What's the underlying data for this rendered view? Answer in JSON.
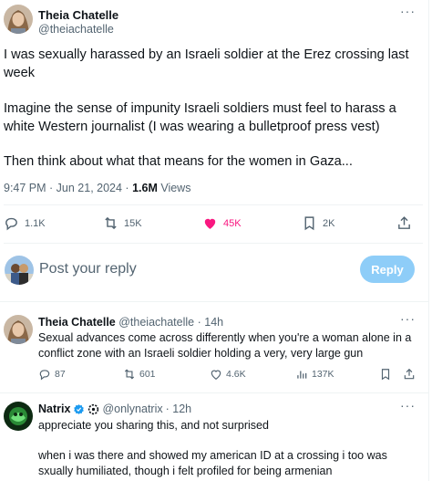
{
  "tweet": {
    "author_name": "Theia Chatelle",
    "author_handle": "@theiachatelle",
    "more": "···",
    "paragraphs": [
      "I was sexually harassed by an Israeli soldier at the Erez crossing last week",
      "Imagine the sense of impunity Israeli soldiers must feel to harass a white Western journalist (I was wearing a bulletproof press vest)",
      "Then think about what that means for the women in Gaza..."
    ],
    "time": "9:47 PM · Jun 21, 2024 · ",
    "views_count": "1.6M",
    "views_label": " Views",
    "actions": {
      "replies": "1.1K",
      "reposts": "15K",
      "likes": "45K",
      "bookmarks": "2K"
    },
    "like_color": "#f91880"
  },
  "reply_box": {
    "placeholder": "Post your reply",
    "button": "Reply"
  },
  "comments": [
    {
      "name": "Theia Chatelle",
      "handle": "@theiachatelle",
      "time": "· 14h",
      "more": "···",
      "text": "Sexual advances come across differently when you're a woman alone in a conflict zone with an Israeli soldier holding a very, very large gun",
      "replies": "87",
      "reposts": "601",
      "likes": "4.6K",
      "views": "137K"
    },
    {
      "name": "Natrix",
      "handle": "@onlynatrix",
      "time": "· 12h",
      "more": "···",
      "paragraphs": [
        "appreciate you sharing this, and not surprised",
        "when i was there and showed my american ID at a crossing i too was sxually humiliated, though i felt profiled for being armenian"
      ]
    }
  ],
  "colors": {
    "secondary_text": "#536471",
    "reply_button": "#8ecdf8",
    "verified": "#1d9bf0"
  }
}
